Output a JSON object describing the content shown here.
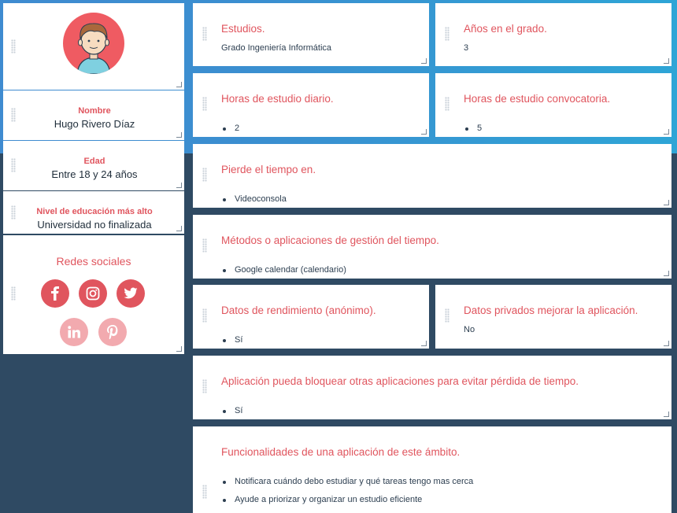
{
  "profile": {
    "name_label": "Nombre",
    "name_value": "Hugo Rivero Díaz",
    "age_label": "Edad",
    "age_value": "Entre 18 y 24 años",
    "education_label": "Nivel de educación más alto",
    "education_value": "Universidad no finalizada",
    "social_title": "Redes sociales",
    "social_icons": [
      "facebook-icon",
      "instagram-icon",
      "twitter-icon",
      "linkedin-icon",
      "pinterest-icon"
    ]
  },
  "colors": {
    "accent": "#e0555e",
    "accent_light": "#f2aaaf",
    "header_blue": "#3a8fd0",
    "dark_bg": "#2f4a63"
  },
  "questions": {
    "estudios": {
      "title": "Estudios.",
      "answer": "Grado Ingeniería Informática"
    },
    "anios": {
      "title": "Años en el grado.",
      "answer": "3"
    },
    "horas_diario": {
      "title": "Horas de estudio diario.",
      "answer": "2"
    },
    "horas_convocatoria": {
      "title": "Horas de estudio convocatoria.",
      "answer": "5"
    },
    "pierde": {
      "title": "Pierde el tiempo en.",
      "answer": "Videoconsola"
    },
    "metodos": {
      "title": "Métodos o aplicaciones de gestión del tiempo.",
      "answer": "Google calendar (calendario)"
    },
    "rendimiento": {
      "title": "Datos de rendimiento (anónimo).",
      "answer": "Sí"
    },
    "privados": {
      "title": "Datos privados mejorar la aplicación.",
      "answer": "No"
    },
    "bloquear": {
      "title": "Aplicación pueda bloquear otras aplicaciones para evitar pérdida de tiempo.",
      "answer": "Sí"
    },
    "funcionalidades": {
      "title": "Funcionalidades de una aplicación de este ámbito.",
      "answers": [
        "Notificara cuándo debo estudiar y qué tareas tengo mas cerca",
        "Ayude a priorizar y organizar un estudio eficiente"
      ]
    }
  }
}
